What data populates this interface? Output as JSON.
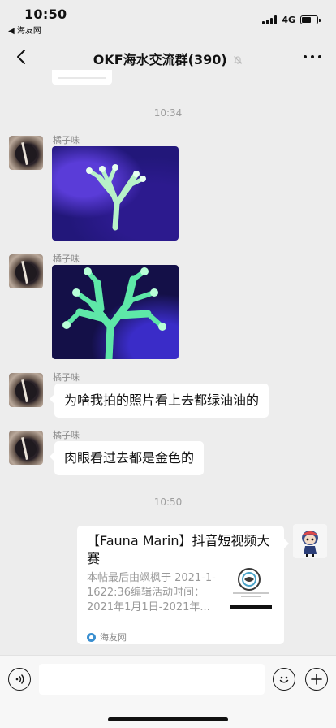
{
  "status_bar": {
    "time": "10:50",
    "back_app": "◀ 海友网",
    "network": "4G",
    "battery_level": 0.6
  },
  "nav": {
    "title": "OKF海水交流群(390)",
    "back_icon": "chevron-left-icon",
    "muted_icon": "muted-bell-icon",
    "more_icon": "more-dots-icon"
  },
  "timestamps": [
    "10:34",
    "10:50"
  ],
  "messages": [
    {
      "sender": "橘子味",
      "type": "image",
      "image": "coral-photo-1"
    },
    {
      "sender": "橘子味",
      "type": "image",
      "image": "coral-photo-2"
    },
    {
      "sender": "橘子味",
      "type": "text",
      "text": "为啥我拍的照片看上去都绿油油的"
    },
    {
      "sender": "橘子味",
      "type": "text",
      "text": "肉眼看过去都是金色的"
    }
  ],
  "link_card": {
    "title": "【Fauna Marin】抖音短视频大赛",
    "description": "本帖最后由飒枫于 2021-1-1622:36编辑活动时间：2021年1月1日-2021年...",
    "source": "海友网"
  },
  "input_bar": {
    "voice_icon": "voice-icon",
    "emoji_icon": "emoji-icon",
    "add_icon": "add-icon"
  }
}
